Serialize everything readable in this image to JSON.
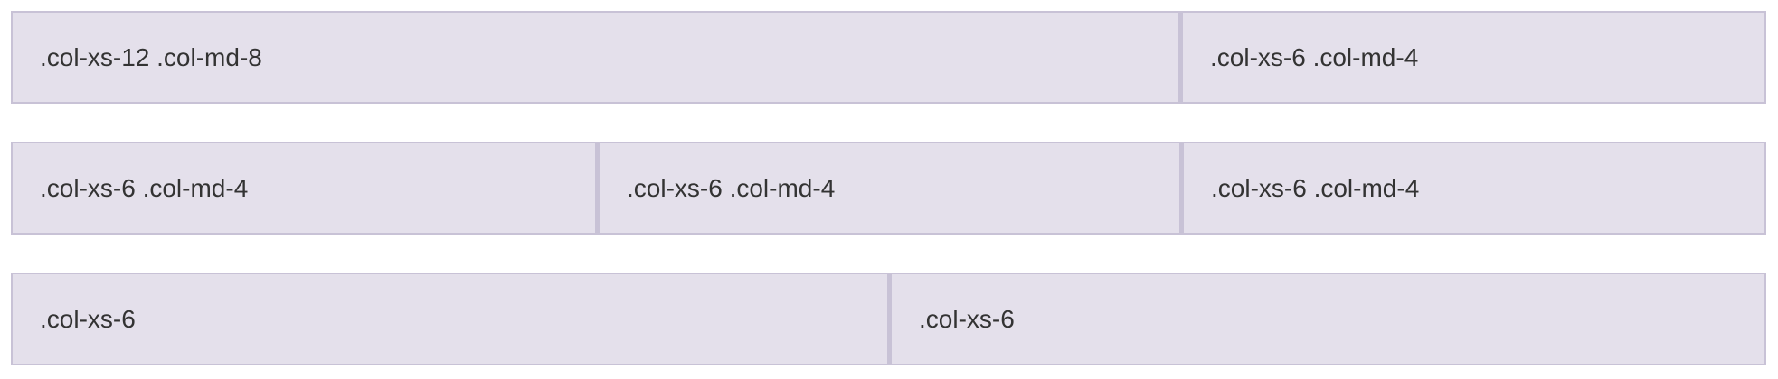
{
  "rows": [
    {
      "cols": [
        {
          "label": ".col-xs-12 .col-md-8"
        },
        {
          "label": ".col-xs-6 .col-md-4"
        }
      ]
    },
    {
      "cols": [
        {
          "label": ".col-xs-6 .col-md-4"
        },
        {
          "label": ".col-xs-6 .col-md-4"
        },
        {
          "label": ".col-xs-6 .col-md-4"
        }
      ]
    },
    {
      "cols": [
        {
          "label": ".col-xs-6"
        },
        {
          "label": ".col-xs-6"
        }
      ]
    }
  ],
  "colors": {
    "cell_background": "#e4e0eb",
    "cell_border": "#c8c2d6",
    "text": "#333333"
  }
}
